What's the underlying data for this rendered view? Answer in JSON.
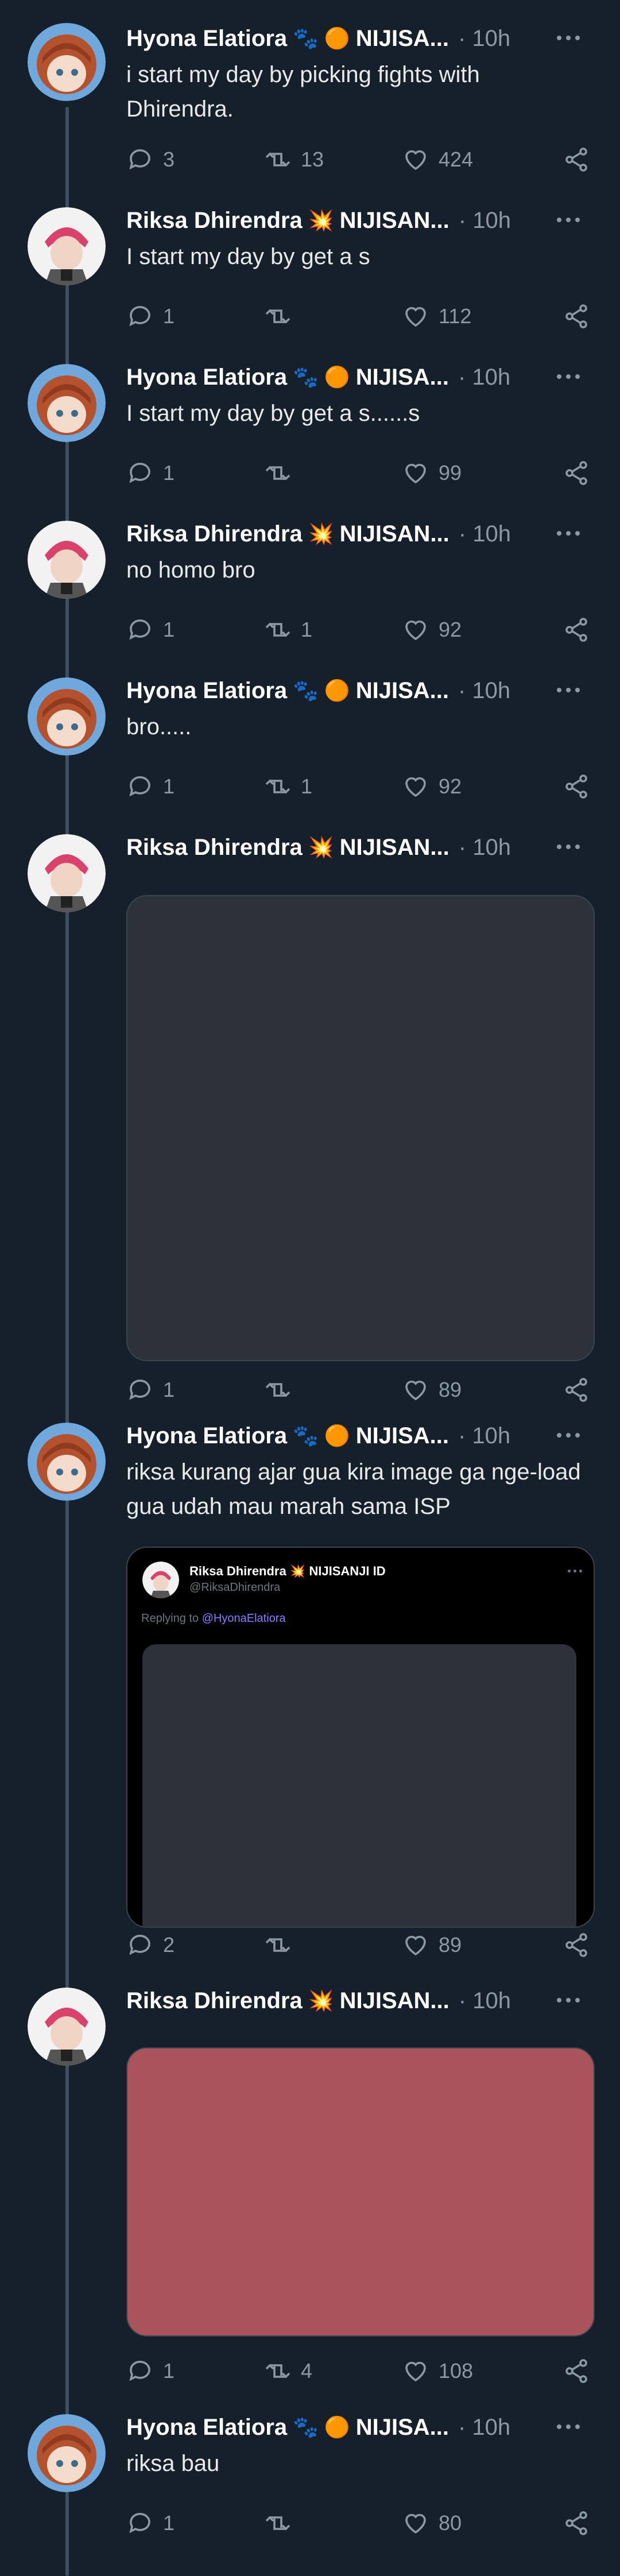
{
  "users": {
    "hyona": {
      "name": "Hyona Elatiora",
      "emoji1": "🐾",
      "emoji2": "🟠",
      "tag": "NIJISA..."
    },
    "riksa": {
      "name": "Riksa Dhirendra",
      "emoji1": "💥",
      "tag": "NIJISAN..."
    }
  },
  "tweets": [
    {
      "author": "hyona",
      "time": "· 10h",
      "text": "i start my day by picking fights with Dhirendra.",
      "reply": "3",
      "retweet": "13",
      "like": "424"
    },
    {
      "author": "riksa",
      "time": "· 10h",
      "text": "I start my day by get a s",
      "reply": "1",
      "retweet": "",
      "like": "112"
    },
    {
      "author": "hyona",
      "time": "· 10h",
      "text": "I start my day by get a s......s",
      "reply": "1",
      "retweet": "",
      "like": "99"
    },
    {
      "author": "riksa",
      "time": "· 10h",
      "text": "no homo bro",
      "reply": "1",
      "retweet": "1",
      "like": "92"
    },
    {
      "author": "hyona",
      "time": "· 10h",
      "text": "bro.....",
      "reply": "1",
      "retweet": "1",
      "like": "92"
    },
    {
      "author": "riksa",
      "time": "· 10h",
      "text": "",
      "reply": "1",
      "retweet": "",
      "like": "89",
      "media_color": "#2d3139"
    },
    {
      "author": "hyona",
      "time": "· 10h",
      "text": "riksa kurang ajar gua kira image ga nge-load gua udah mau marah sama ISP",
      "reply": "2",
      "retweet": "",
      "like": "89",
      "quote": {
        "name": "Riksa Dhirendra 💥 NIJISANJI ID",
        "handle": "@RiksaDhirendra",
        "replying_prefix": "Replying to ",
        "replying_to": "@HyonaElatiora"
      }
    },
    {
      "author": "riksa",
      "time": "· 10h",
      "text": "",
      "reply": "1",
      "retweet": "4",
      "like": "108",
      "media_color": "#a9545c"
    },
    {
      "author": "hyona",
      "time": "· 10h",
      "text": "riksa bau",
      "reply": "1",
      "retweet": "",
      "like": "80"
    }
  ]
}
